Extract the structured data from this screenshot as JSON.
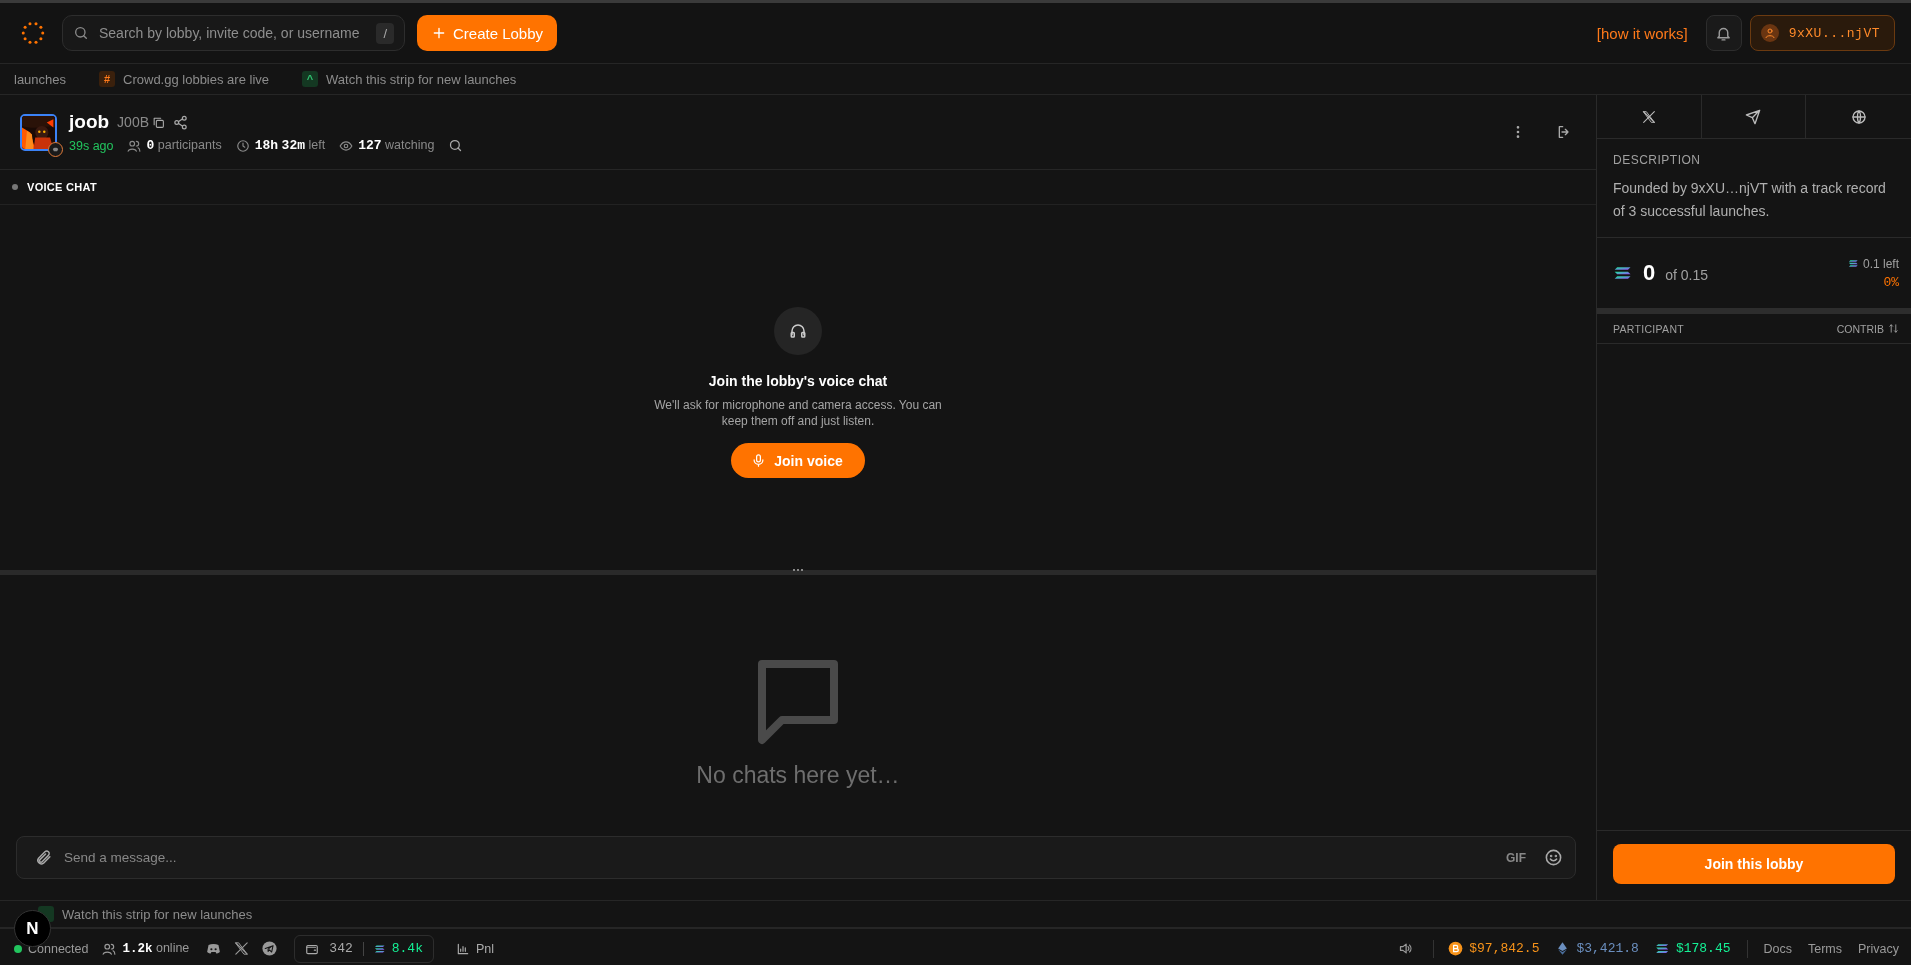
{
  "topbar": {
    "search": {
      "placeholder": "Search by lobby, invite code, or username",
      "shortcut": "/"
    },
    "create_button": "Create Lobby",
    "how_link": "[how it works]",
    "wallet": "9xXU...njVT"
  },
  "ticker_top": [
    {
      "kind": "plain",
      "text": "launches"
    },
    {
      "kind": "hash",
      "icon": "#",
      "text": "Crowd.gg lobbies are live"
    },
    {
      "kind": "up",
      "icon": "^",
      "text": "Watch this strip for new launches"
    }
  ],
  "lobby": {
    "name": "joob",
    "ticker": "J00B",
    "age": "39s ago",
    "stats": [
      {
        "kind": "people",
        "text": "**0** participants"
      },
      {
        "kind": "clock",
        "text": "**18h** **32m** left"
      },
      {
        "kind": "eye",
        "text": "**127** watching"
      }
    ]
  },
  "voice": {
    "section": "VOICE CHAT",
    "title": "Join the lobby's voice chat",
    "body": "We'll ask for microphone and camera access. You can keep them off and just listen.",
    "button": "Join voice"
  },
  "chat": {
    "empty": "No chats here yet…",
    "placeholder": "Send a message...",
    "gif": "GIF"
  },
  "sidebar": {
    "description_label": "DESCRIPTION",
    "description": "Founded by 9xXU…njVT with a track record of 3 successful launches.",
    "amount": "0",
    "of": "of 0.15",
    "left": "0.1 left",
    "percent": "0%",
    "level": 0,
    "columns": [
      "PARTICIPANT",
      "CONTRIB"
    ],
    "join_button": "Join this lobby"
  },
  "ticker_bottom": [
    {
      "kind": "up",
      "text": "Watch this strip for new launches"
    }
  ],
  "status_bar": {
    "connection": "Connected",
    "connected": true,
    "online": "**1.2k** online",
    "wallet_count": "342",
    "balance": "8.4k",
    "pnl": "Pnl",
    "prices": [
      {
        "kind": "btc",
        "value": "$97,842.5"
      },
      {
        "kind": "eth",
        "value": "$3,421.8"
      },
      {
        "kind": "sol",
        "value": "$178.45"
      }
    ],
    "links": [
      "Docs",
      "Terms",
      "Privacy"
    ]
  },
  "dev_badge": "N"
}
